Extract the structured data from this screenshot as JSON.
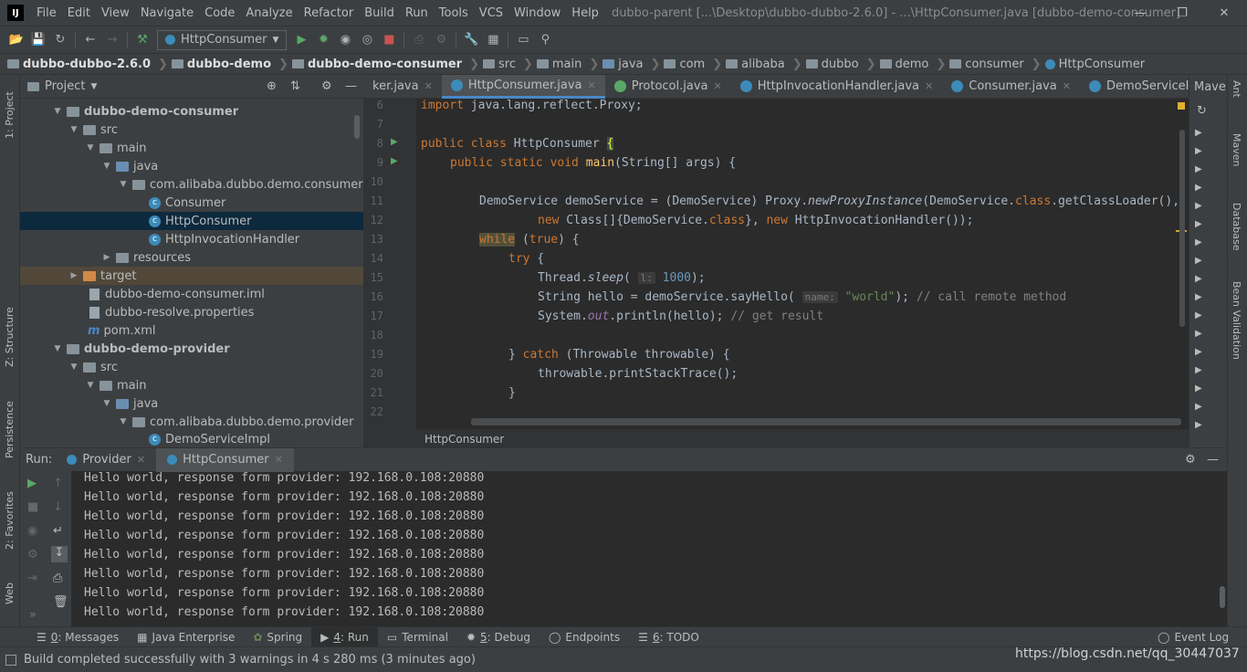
{
  "menubar": {
    "logo": "IJ",
    "items": [
      "File",
      "Edit",
      "View",
      "Navigate",
      "Code",
      "Analyze",
      "Refactor",
      "Build",
      "Run",
      "Tools",
      "VCS",
      "Window",
      "Help"
    ],
    "title": "dubbo-parent [...\\Desktop\\dubbo-dubbo-2.6.0] - ...\\HttpConsumer.java [dubbo-demo-consumer]"
  },
  "toolbar": {
    "run_config": "HttpConsumer"
  },
  "navbar": {
    "crumbs": [
      "dubbo-dubbo-2.6.0",
      "dubbo-demo",
      "dubbo-demo-consumer",
      "src",
      "main",
      "java",
      "com",
      "alibaba",
      "dubbo",
      "demo",
      "consumer",
      "HttpConsumer"
    ]
  },
  "left_strip": {
    "project": "1: Project",
    "structure": "Z: Structure",
    "persistence": "Persistence",
    "favorites": "2: Favorites",
    "web": "Web"
  },
  "project_panel": {
    "title": "Project",
    "tree": [
      {
        "label": "dubbo-demo-consumer",
        "bold": true
      },
      {
        "label": "src"
      },
      {
        "label": "main"
      },
      {
        "label": "java"
      },
      {
        "label": "com.alibaba.dubbo.demo.consumer"
      },
      {
        "label": "Consumer"
      },
      {
        "label": "HttpConsumer"
      },
      {
        "label": "HttpInvocationHandler"
      },
      {
        "label": "resources"
      },
      {
        "label": "target"
      },
      {
        "label": "dubbo-demo-consumer.iml"
      },
      {
        "label": "dubbo-resolve.properties"
      },
      {
        "label": "pom.xml"
      },
      {
        "label": "dubbo-demo-provider",
        "bold": true
      },
      {
        "label": "src"
      },
      {
        "label": "main"
      },
      {
        "label": "java"
      },
      {
        "label": "com.alibaba.dubbo.demo.provider"
      },
      {
        "label": "DemoServiceImpl"
      }
    ]
  },
  "editor": {
    "tabs": [
      "ker.java",
      "HttpConsumer.java",
      "Protocol.java",
      "HttpInvocationHandler.java",
      "Consumer.java",
      "DemoServiceImpl.java"
    ],
    "tabs_overflow": "≡",
    "line_numbers": [
      "6",
      "7",
      "8",
      "9",
      "10",
      "11",
      "12",
      "13",
      "14",
      "15",
      "16",
      "17",
      "18",
      "19",
      "20",
      "21",
      "22"
    ],
    "breadcrumb": "HttpConsumer"
  },
  "maven": {
    "title": "Maven"
  },
  "right_strip": {
    "ant": "Ant",
    "maven": "Maven",
    "database": "Database",
    "bean": "Bean Validation"
  },
  "run": {
    "label": "Run:",
    "tabs": [
      "Provider",
      "HttpConsumer"
    ],
    "output": [
      "Hello world, response form provider: 192.168.0.108:20880",
      "Hello world, response form provider: 192.168.0.108:20880",
      "Hello world, response form provider: 192.168.0.108:20880",
      "Hello world, response form provider: 192.168.0.108:20880",
      "Hello world, response form provider: 192.168.0.108:20880",
      "Hello world, response form provider: 192.168.0.108:20880",
      "Hello world, response form provider: 192.168.0.108:20880",
      "Hello world, response form provider: 192.168.0.108:20880"
    ]
  },
  "toolwindows": {
    "items": [
      {
        "num": "0",
        "label": ": Messages"
      },
      {
        "num": "",
        "label": "Java Enterprise"
      },
      {
        "num": "",
        "label": "Spring"
      },
      {
        "num": "4",
        "label": ": Run"
      },
      {
        "num": "",
        "label": "Terminal"
      },
      {
        "num": "5",
        "label": ": Debug"
      },
      {
        "num": "",
        "label": "Endpoints"
      },
      {
        "num": "6",
        "label": ": TODO"
      }
    ],
    "event_log": "Event Log"
  },
  "status": {
    "message": "Build completed successfully with 3 warnings in 4 s 280 ms (3 minutes ago)"
  },
  "watermark": "https://blog.csdn.net/qq_30447037"
}
